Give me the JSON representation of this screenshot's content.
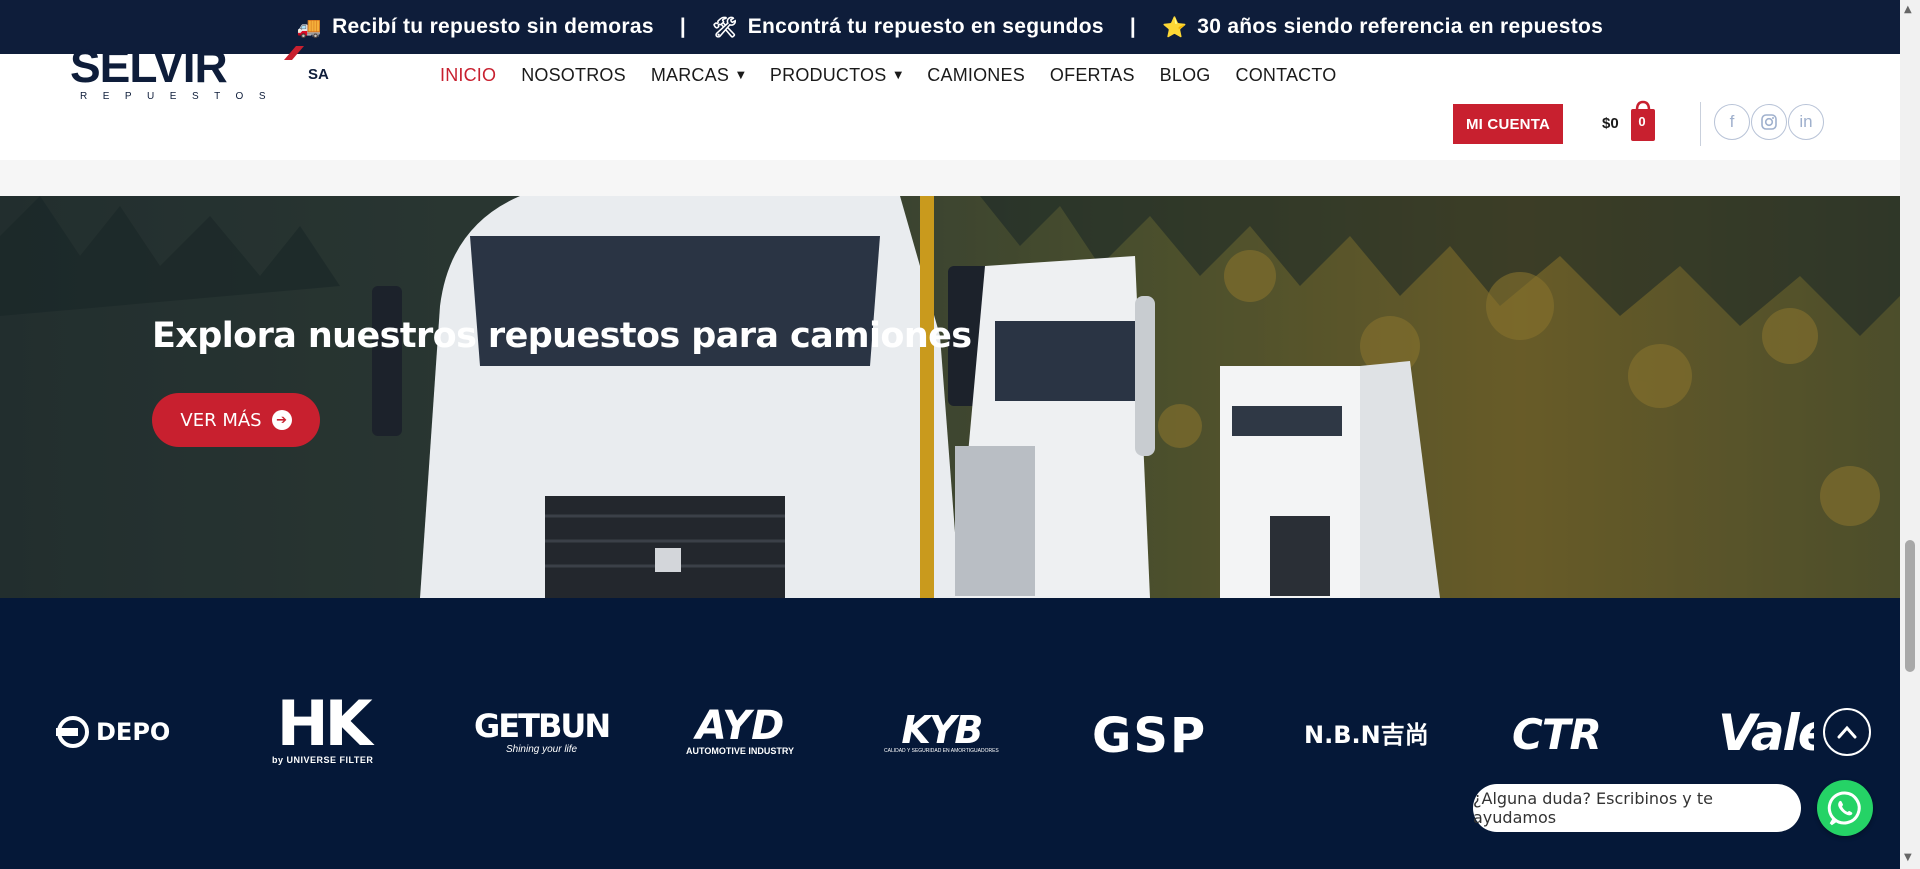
{
  "topbar": {
    "items": [
      {
        "icon": "🚚",
        "icon_name": "truck-icon",
        "text": "Recibí tu repuesto sin demoras"
      },
      {
        "icon": "🛠",
        "icon_name": "tools-icon",
        "text": "Encontrá tu repuesto en segundos"
      },
      {
        "icon": "⭐",
        "icon_name": "star-icon",
        "text": "30 años siendo referencia en repuestos"
      }
    ],
    "separator": "|",
    "background": "#0e1d3a"
  },
  "header": {
    "logo": {
      "name": "SELVIR",
      "suffix": "SA",
      "tagline": "REPUESTOS"
    },
    "nav": [
      {
        "label": "INICIO",
        "active": true
      },
      {
        "label": "NOSOTROS"
      },
      {
        "label": "MARCAS",
        "dropdown": true
      },
      {
        "label": "PRODUCTOS",
        "dropdown": true
      },
      {
        "label": "CAMIONES"
      },
      {
        "label": "OFERTAS"
      },
      {
        "label": "BLOG"
      },
      {
        "label": "CONTACTO"
      }
    ],
    "caret": "▼",
    "account_label": "MI CUENTA",
    "cart_total": "$0",
    "cart_count": "0",
    "social": [
      {
        "icon": "facebook-icon",
        "glyph": "f"
      },
      {
        "icon": "instagram-icon",
        "glyph": ""
      },
      {
        "icon": "linkedin-icon",
        "glyph": "in"
      }
    ]
  },
  "hero": {
    "title": "Explora nuestros repuestos para camiones",
    "button_label": "VER MÁS"
  },
  "brands": [
    {
      "name": "DEPO"
    },
    {
      "name": "HK",
      "sub": "by UNIVERSE FILTER"
    },
    {
      "name": "GETBUN",
      "sub": "Shining your life"
    },
    {
      "name": "AYD",
      "sub": "AUTOMOTIVE INDUSTRY"
    },
    {
      "name": "KYB",
      "sub": "CALIDAD Y SEGURIDAD EN AMORTIGUADORES"
    },
    {
      "name": "GSP"
    },
    {
      "name": "N.B.N吉尚"
    },
    {
      "name": "CTR"
    },
    {
      "name": "Valeo"
    }
  ],
  "chat": {
    "text": "¿Alguna duda? Escribinos y te ayudamos"
  },
  "colors": {
    "brand_red": "#c8202f",
    "navy": "#051838",
    "whatsapp": "#25d366"
  }
}
